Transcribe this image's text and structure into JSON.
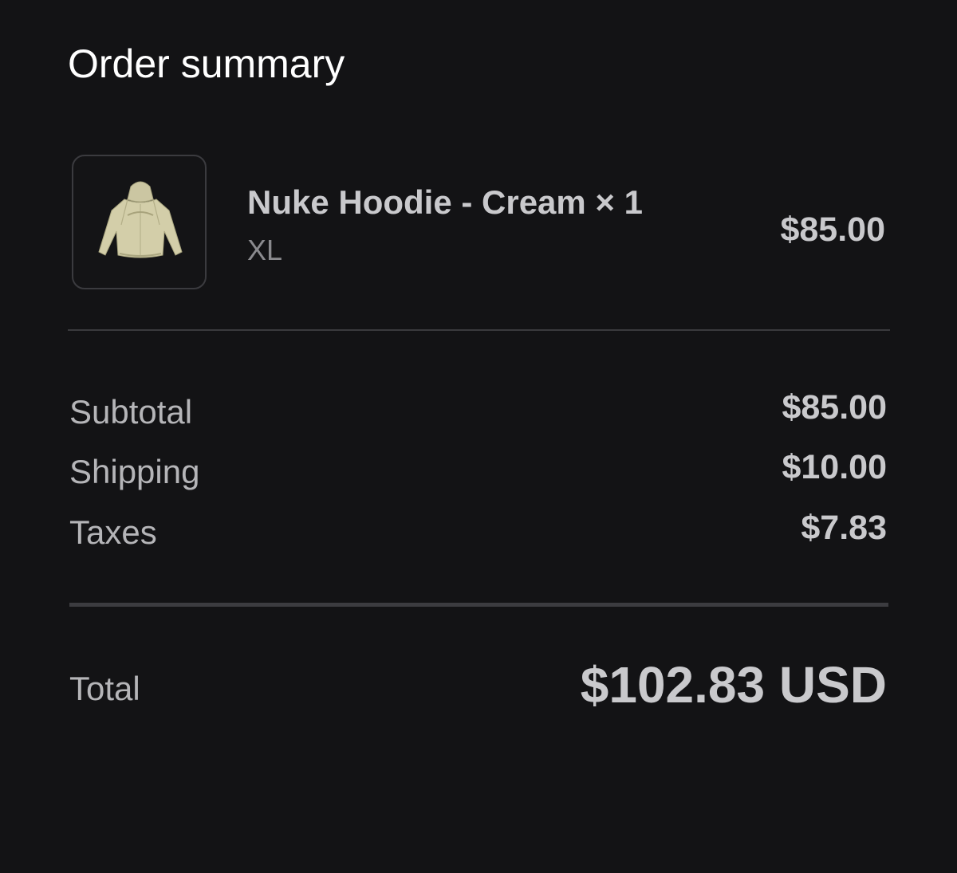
{
  "header": {
    "title": "Order summary"
  },
  "item": {
    "image_icon": "hoodie-product-image",
    "name": "Nuke Hoodie - Cream × 1",
    "variant": "XL",
    "price": "$85.00"
  },
  "summary": {
    "subtotal_label": "Subtotal",
    "subtotal_value": "$85.00",
    "shipping_label": "Shipping",
    "shipping_value": "$10.00",
    "taxes_label": "Taxes",
    "taxes_value": "$7.83"
  },
  "total": {
    "label": "Total",
    "value": "$102.83 USD"
  },
  "colors": {
    "background": "#131315",
    "text_primary": "#c9c9cc",
    "text_secondary": "#8a8a8e",
    "divider": "#3a3a3d",
    "product_cream": "#cfcaa6"
  }
}
